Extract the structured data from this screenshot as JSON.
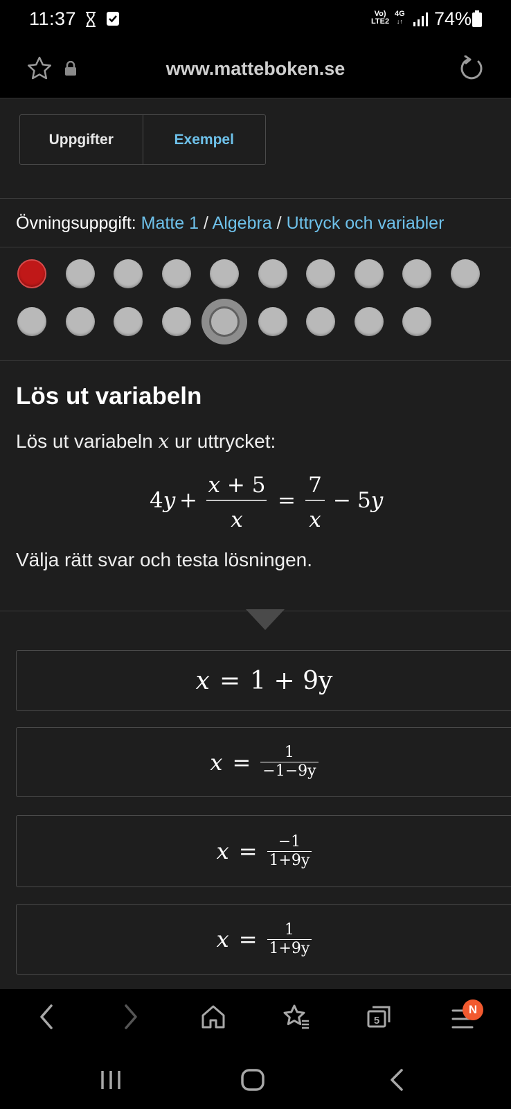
{
  "status_bar": {
    "time": "11:37",
    "net_line1": "Vo)",
    "net_line2": "LTE2",
    "net_type": "4G",
    "battery": "74%"
  },
  "browser": {
    "url": "www.matteboken.se",
    "open_tabs_count": "5",
    "menu_badge": "N"
  },
  "tabs": {
    "uppgifter": "Uppgifter",
    "exempel": "Exempel"
  },
  "breadcrumb": {
    "label": "Övningsuppgift:",
    "links": [
      "Matte 1",
      "Algebra",
      "Uttryck och variabler"
    ],
    "separator": "/"
  },
  "progress": {
    "total": 19,
    "wrong": [
      1
    ],
    "current": 15
  },
  "problem": {
    "title": "Lös ut variabeln",
    "text_before": "Lös ut variabeln ",
    "variable": "x",
    "text_after": " ur uttrycket:",
    "instruction": "Välja rätt svar och testa lösningen."
  },
  "equation": {
    "lhs_coeff": "4",
    "lhs_var": "y",
    "plus": "+",
    "frac1_num": "x + 5",
    "frac1_den": "x",
    "equals": "=",
    "frac2_num": "7",
    "frac2_den": "x",
    "minus": "−",
    "rhs_coeff": "5",
    "rhs_var": "y"
  },
  "answers": [
    {
      "lhs": "x",
      "rhs": "1 + 9y"
    },
    {
      "lhs": "x",
      "num": "1",
      "den": "−1−9y"
    },
    {
      "lhs": "x",
      "num": "−1",
      "den": "1+9y"
    },
    {
      "lhs": "x",
      "num": "1",
      "den": "1+9y"
    }
  ],
  "colors": {
    "accent": "#6ec1ea",
    "wrong": "#c01818",
    "background": "#1e1e1e",
    "dot": "#b9b9b9"
  }
}
